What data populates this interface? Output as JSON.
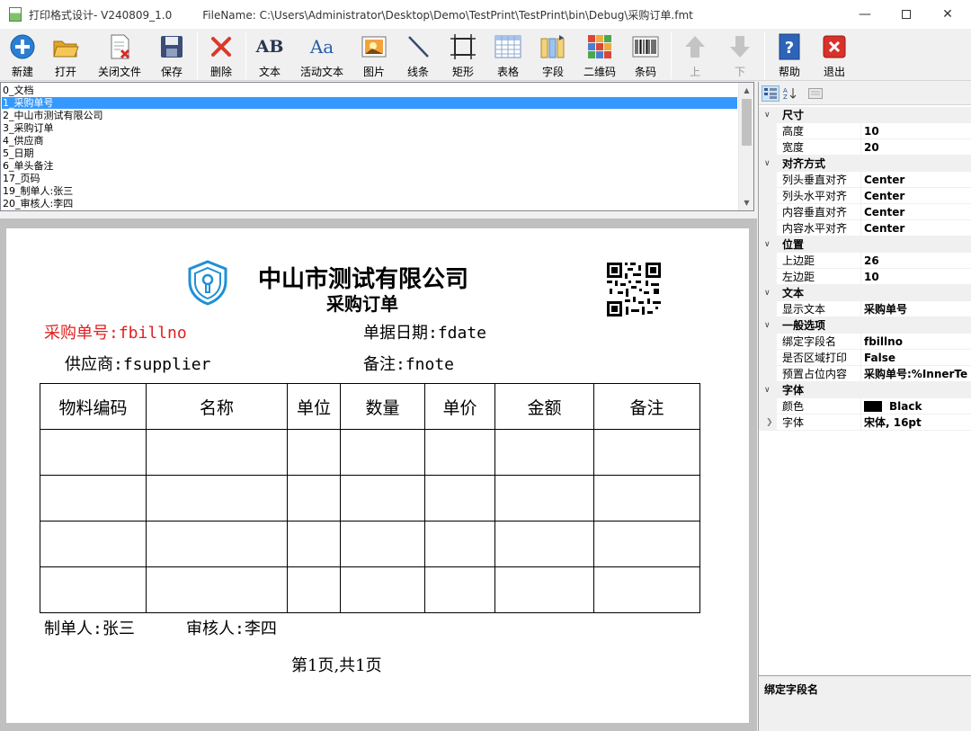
{
  "window": {
    "title": "打印格式设计- V240809_1.0",
    "filename": "FileName:  C:\\Users\\Administrator\\Desktop\\Demo\\TestPrint\\TestPrint\\bin\\Debug\\采购订单.fmt"
  },
  "toolbar": [
    {
      "label": "新建",
      "icon": "new-icon"
    },
    {
      "label": "打开",
      "icon": "folder-open-icon"
    },
    {
      "label": "关闭文件",
      "icon": "close-file-icon"
    },
    {
      "label": "保存",
      "icon": "save-icon"
    },
    {
      "label": "删除",
      "icon": "delete-icon"
    },
    {
      "label": "文本",
      "icon": "text-icon",
      "glyph": "AB"
    },
    {
      "label": "活动文本",
      "icon": "dynamic-text-icon",
      "glyph": "Aa"
    },
    {
      "label": "图片",
      "icon": "picture-icon"
    },
    {
      "label": "线条",
      "icon": "line-icon"
    },
    {
      "label": "矩形",
      "icon": "rectangle-icon"
    },
    {
      "label": "表格",
      "icon": "table-icon"
    },
    {
      "label": "字段",
      "icon": "field-icon"
    },
    {
      "label": "二维码",
      "icon": "qrcode-icon"
    },
    {
      "label": "条码",
      "icon": "barcode-icon"
    },
    {
      "label": "上",
      "icon": "arrow-up-icon"
    },
    {
      "label": "下",
      "icon": "arrow-down-icon"
    },
    {
      "label": "帮助",
      "icon": "help-icon"
    },
    {
      "label": "退出",
      "icon": "exit-icon"
    }
  ],
  "object_list": [
    "0_文档",
    "1_采购单号",
    "2_中山市测试有限公司",
    "3_采购订单",
    "4_供应商",
    "5_日期",
    "6_单头备注",
    "17_页码",
    "19_制单人:张三",
    "20_审核人:李四"
  ],
  "object_list_selected": 1,
  "paper": {
    "company": "中山市测试有限公司",
    "subtitle": "采购订单",
    "billno": "采购单号:fbillno",
    "fdate": "单据日期:fdate",
    "supplier": "供应商:fsupplier",
    "fnote": "备注:fnote",
    "table_headers": [
      "物料编码",
      "名称",
      "单位",
      "数量",
      "单价",
      "金额",
      "备注"
    ],
    "maker": "制单人:张三",
    "auditor": "审核人:李四",
    "page_info": "第1页,共1页"
  },
  "properties": [
    {
      "category": "尺寸",
      "rows": [
        [
          "高度",
          "10"
        ],
        [
          "宽度",
          "20"
        ]
      ]
    },
    {
      "category": "对齐方式",
      "rows": [
        [
          "列头垂直对齐",
          "Center"
        ],
        [
          "列头水平对齐",
          "Center"
        ],
        [
          "内容垂直对齐",
          "Center"
        ],
        [
          "内容水平对齐",
          "Center"
        ]
      ]
    },
    {
      "category": "位置",
      "rows": [
        [
          "上边距",
          "26"
        ],
        [
          "左边距",
          "10"
        ]
      ]
    },
    {
      "category": "文本",
      "rows": [
        [
          "显示文本",
          "采购单号"
        ]
      ]
    },
    {
      "category": "一般选项",
      "rows": [
        [
          "绑定字段名",
          "fbillno"
        ],
        [
          "是否区域打印",
          "False"
        ],
        [
          "预置占位内容",
          "采购单号:%InnerTe"
        ]
      ]
    },
    {
      "category": "字体",
      "rows": [
        [
          "颜色",
          "Black"
        ],
        [
          "字体",
          "宋体, 16pt"
        ]
      ]
    }
  ],
  "property_description": "绑定字段名",
  "colors": {
    "selection": "#3399ff",
    "accent_red": "#e02020",
    "shield_blue": "#1e90d6"
  }
}
